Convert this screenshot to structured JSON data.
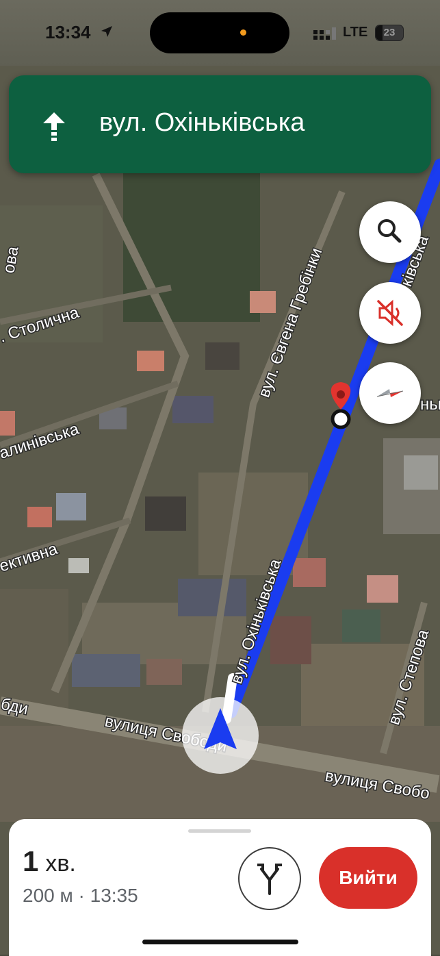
{
  "status_bar": {
    "time": "13:34",
    "network": "LTE",
    "battery": "23"
  },
  "banner": {
    "direction_icon": "arrow-up-icon",
    "street": "вул. Охіньківська"
  },
  "map": {
    "street_labels": [
      "вул. Охіньківська",
      "вул. Євгена Гребінки",
      "вулиця Свободи",
      "вулиця Свобо",
      "вул. Степова",
      ". Столична",
      "алинівська",
      "ективна",
      "бди",
      "ова",
      "ківська",
      "ньк"
    ]
  },
  "controls": {
    "search_icon": "search-icon",
    "mute_icon": "sound-off-icon",
    "compass_icon": "compass-icon"
  },
  "trip": {
    "minutes": "1",
    "unit": "хв.",
    "details": "200 м · 13:35",
    "exit_label": "Вийти",
    "routes_icon": "alternate-routes-icon"
  },
  "colors": {
    "banner": "#0d6040",
    "route": "#1a3cf0",
    "exit": "#d9302a",
    "destination_pin": "#e3342f"
  }
}
